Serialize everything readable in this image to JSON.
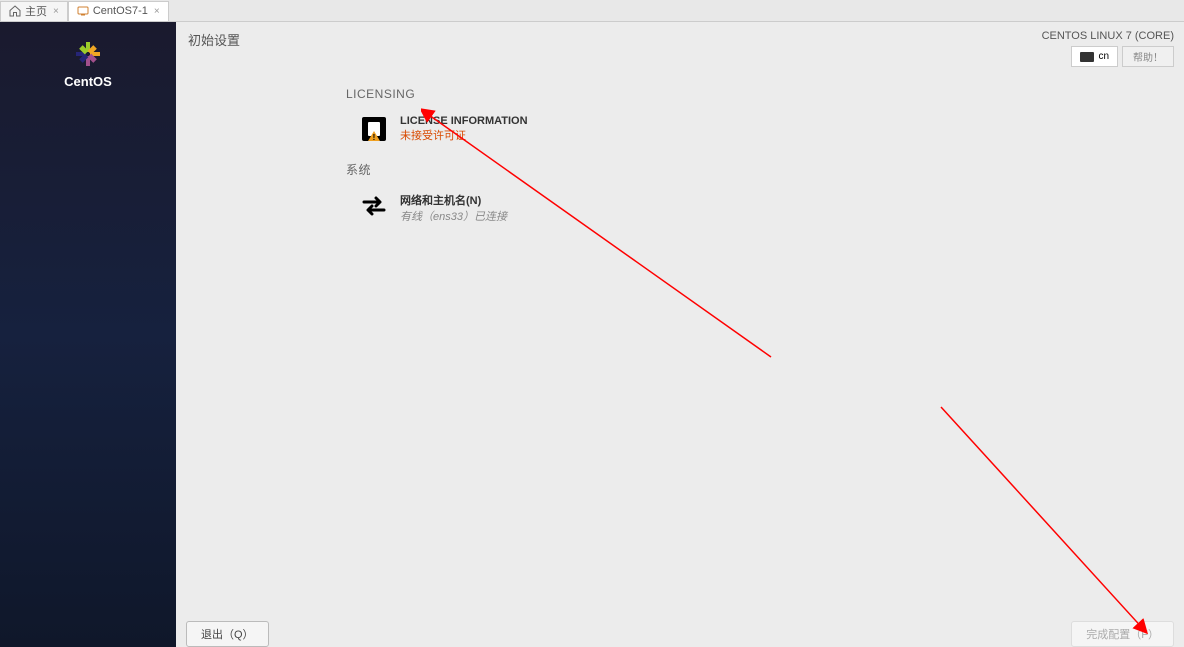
{
  "tabs": {
    "home": {
      "label": "主页"
    },
    "vm": {
      "label": "CentOS7-1"
    }
  },
  "sidebar": {
    "brand": "CentOS"
  },
  "header": {
    "title": "初始设置",
    "os_label": "CENTOS LINUX 7 (CORE)",
    "lang": "cn",
    "help": "帮助！"
  },
  "sections": {
    "licensing": {
      "header": "LICENSING",
      "license_info": {
        "title": "LICENSE INFORMATION",
        "status": "未接受许可证"
      }
    },
    "system": {
      "header": "系统",
      "network": {
        "title": "网络和主机名(N)",
        "status": "有线（ens33）已连接"
      }
    }
  },
  "footer": {
    "quit": "退出（Q）",
    "finish": "完成配置（F）"
  }
}
